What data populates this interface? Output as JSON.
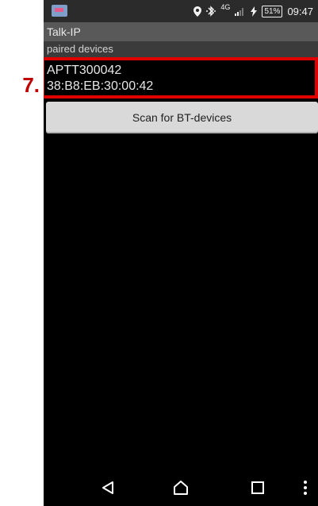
{
  "annotation": {
    "callout_number": "7."
  },
  "status_bar": {
    "network_type": "4G",
    "battery_percent": "51%",
    "time": "09:47",
    "icons": [
      "app-notification-icon",
      "location-icon",
      "bluetooth-icon",
      "signal-icon",
      "charging-icon"
    ]
  },
  "app": {
    "title": "Talk-IP",
    "section_header": "paired devices",
    "devices": [
      {
        "name": "APTT300042",
        "mac": "38:B8:EB:30:00:42"
      }
    ],
    "scan_button_label": "Scan for BT-devices"
  },
  "nav_bar": {
    "buttons": [
      "back-icon",
      "home-icon",
      "recents-icon",
      "overflow-menu-icon"
    ]
  },
  "colors": {
    "highlight": "#e00000",
    "callout": "#c00000",
    "background": "#000000",
    "title_bar": "#595959",
    "button": "#d9d9d9"
  }
}
